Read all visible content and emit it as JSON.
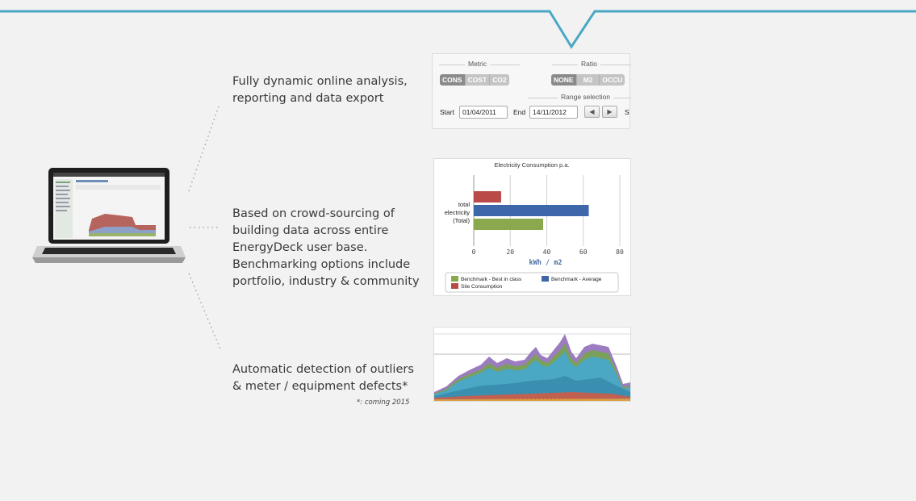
{
  "features": [
    {
      "lines": [
        "Fully dynamic online analysis,",
        "reporting and data export"
      ]
    },
    {
      "lines": [
        "Based on crowd-sourcing of",
        "building data across entire",
        "EnergyDeck user base.",
        "Benchmarking options include",
        "portfolio, industry & community"
      ]
    },
    {
      "lines": [
        "Automatic detection of outliers",
        "& meter / equipment defects*"
      ],
      "footnote": "*: coming 2015"
    }
  ],
  "controls": {
    "metric_label": "Metric",
    "metric_options": [
      "CONS",
      "COST",
      "CO2"
    ],
    "metric_selected": "CONS",
    "ratio_label": "Ratio",
    "ratio_options": [
      "NONE",
      "M2",
      "OCCU"
    ],
    "ratio_selected": "NONE",
    "range_label": "Range selection",
    "start_label": "Start",
    "start_value": "01/04/2011",
    "end_label": "End",
    "end_value": "14/11/2012",
    "prev_icon": "triangle-left-icon",
    "next_icon": "triangle-right-icon",
    "trailing_label": "S"
  },
  "chart_data": {
    "type": "bar",
    "orientation": "horizontal",
    "title": "Electricity Consumption p.a.",
    "categories": [
      "total electricity (Total)"
    ],
    "category_label_lines": [
      "total",
      "electricity",
      "(Total)"
    ],
    "series": [
      {
        "name": "Site Consumption",
        "values": [
          15
        ],
        "color": "#b94a48"
      },
      {
        "name": "Benchmark - Average",
        "values": [
          63
        ],
        "color": "#3d67a8"
      },
      {
        "name": "Benchmark - Best in class",
        "values": [
          38
        ],
        "color": "#8aa84e"
      }
    ],
    "xlabel": "kWh / m2",
    "ylabel": "",
    "xlim": [
      0,
      80
    ],
    "xticks": [
      0,
      20,
      40,
      60,
      80
    ],
    "grid": true,
    "legend_order": [
      "Benchmark - Best in class",
      "Benchmark - Average",
      "Site Consumption"
    ],
    "legend_position": "bottom"
  },
  "colors": {
    "accent_line": "#4aa8c4",
    "page_bg": "#f2f2f2"
  }
}
